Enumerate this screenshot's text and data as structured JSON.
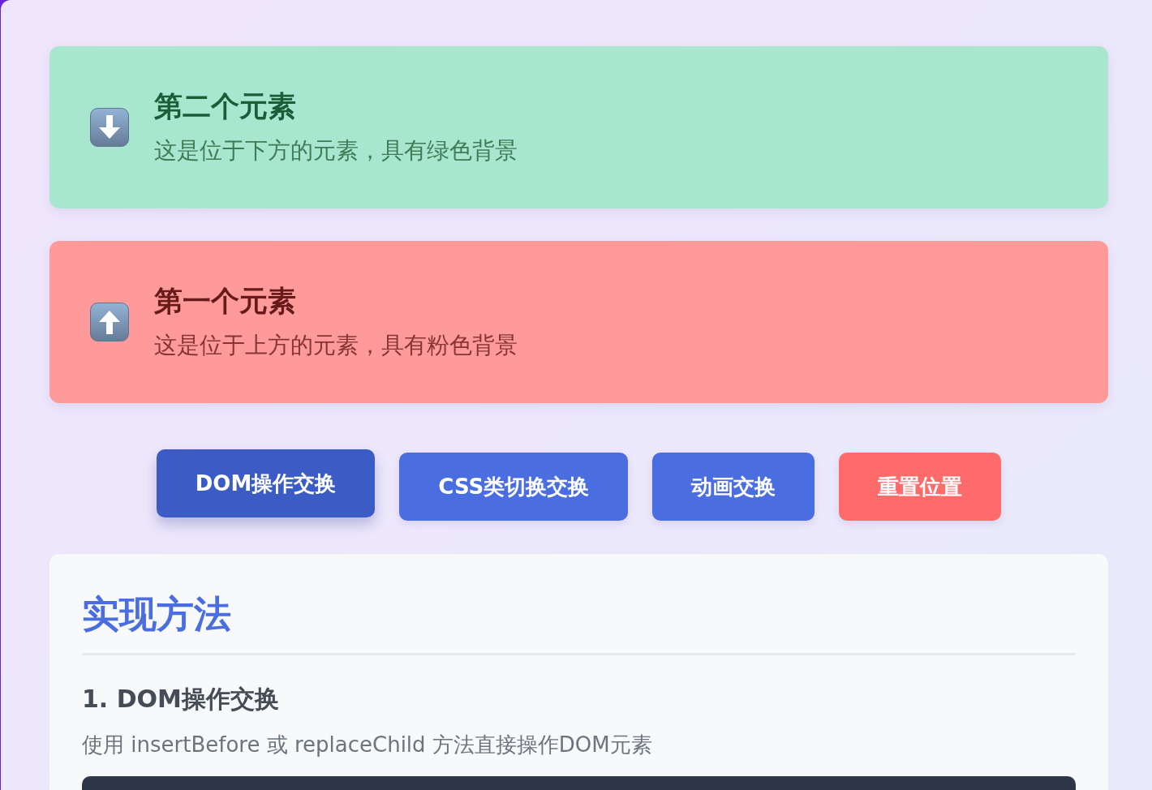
{
  "cards": [
    {
      "kind": "green",
      "title": "第二个元素",
      "description": "这是位于下方的元素，具有绿色背景"
    },
    {
      "kind": "pink",
      "title": "第一个元素",
      "description": "这是位于上方的元素，具有粉色背景"
    }
  ],
  "buttons": [
    {
      "label": "DOM操作交换",
      "kind": "primary",
      "active": true
    },
    {
      "label": "CSS类切换交换",
      "kind": "primary",
      "active": false
    },
    {
      "label": "动画交换",
      "kind": "primary",
      "active": false
    },
    {
      "label": "重置位置",
      "kind": "danger",
      "active": false
    }
  ],
  "panel": {
    "title": "实现方法",
    "sections": [
      {
        "title": "1. DOM操作交换",
        "description": "使用 insertBefore 或 replaceChild 方法直接操作DOM元素",
        "code_block": true
      }
    ]
  }
}
